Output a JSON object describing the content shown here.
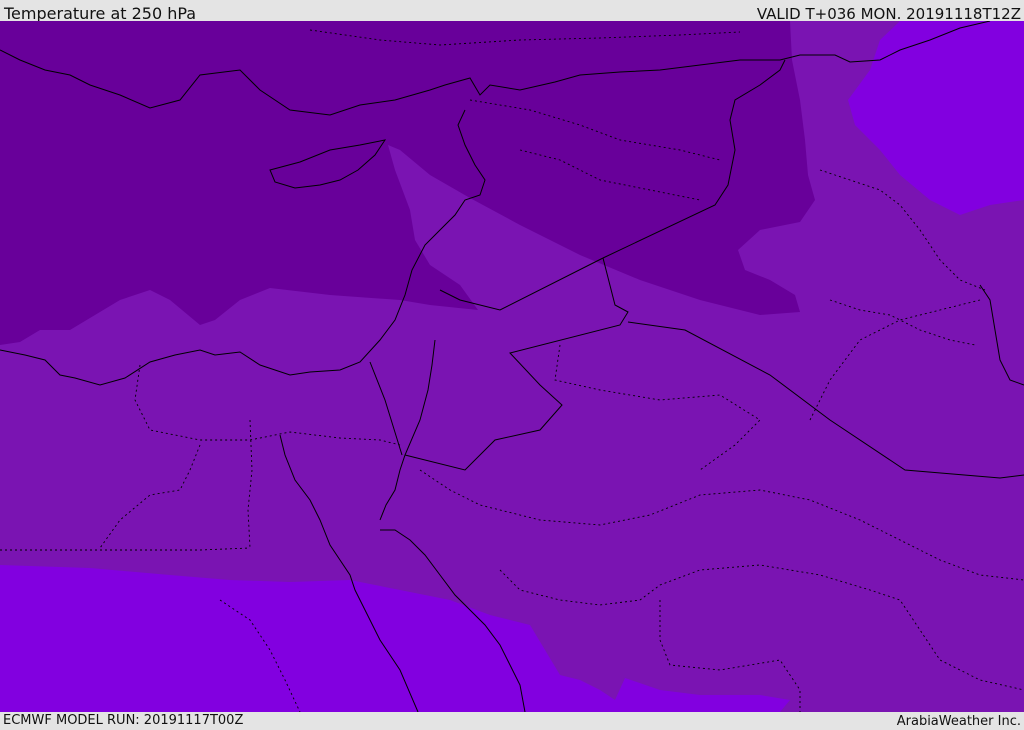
{
  "header": {
    "title": "Temperature at 250 hPa",
    "valid": "VALID T+036 MON. 20191118T12Z"
  },
  "footer": {
    "model_run": "ECMWF MODEL RUN: 20191117T00Z",
    "credit": "ArabiaWeather Inc."
  },
  "colors": {
    "cold": "#68009a",
    "mid": "#7a14b2",
    "warm": "#8200e0",
    "border": "#000000",
    "bar": "#e4e4e4"
  }
}
